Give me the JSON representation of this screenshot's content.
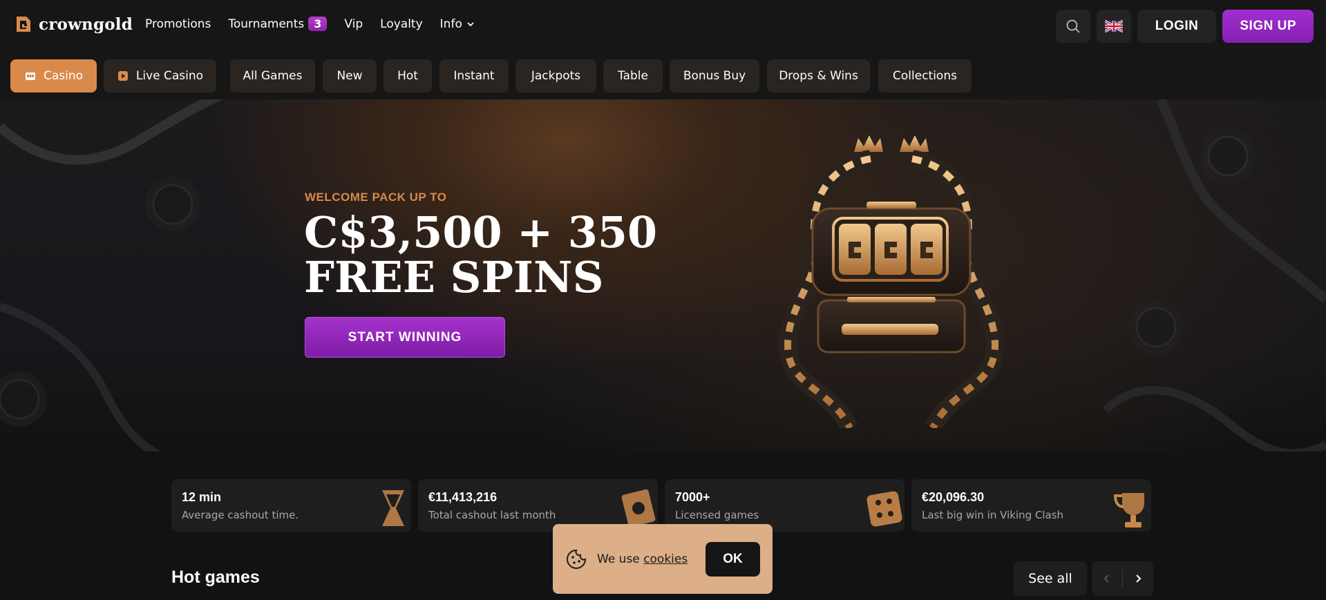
{
  "header": {
    "logo_text": "crowngold",
    "nav": [
      {
        "label": "Promotions"
      },
      {
        "label": "Tournaments",
        "badge": "3"
      },
      {
        "label": "Vip"
      },
      {
        "label": "Loyalty"
      },
      {
        "label": "Info"
      }
    ],
    "login_label": "LOGIN",
    "signup_label": "SIGN UP"
  },
  "categories": [
    {
      "label": "Casino",
      "icon": "casino-icon",
      "active": true
    },
    {
      "label": "Live Casino",
      "icon": "play-icon"
    },
    {
      "label": "All Games"
    },
    {
      "label": "New"
    },
    {
      "label": "Hot"
    },
    {
      "label": "Instant"
    },
    {
      "label": "Jackpots"
    },
    {
      "label": "Table"
    },
    {
      "label": "Bonus Buy"
    },
    {
      "label": "Drops & Wins"
    },
    {
      "label": "Collections"
    }
  ],
  "hero": {
    "subtitle": "WELCOME PACK UP TO",
    "title_line1": "C$3,500 + 350",
    "title_line2": "FREE SPINS",
    "cta": "START WINNING"
  },
  "stats": [
    {
      "value": "12 min",
      "label": "Average cashout time.",
      "icon": "hourglass-icon"
    },
    {
      "value": "€11,413,216",
      "label": "Total cashout last month",
      "icon": "cash-icon"
    },
    {
      "value": "7000+",
      "label": "Licensed games",
      "icon": "dice-icon"
    },
    {
      "value": "€20,096.30",
      "label": "Last big win in Viking Clash",
      "icon": "trophy-icon"
    }
  ],
  "hot_games": {
    "title": "Hot games",
    "see_all": "See all"
  },
  "cookie": {
    "text": "We use",
    "link": "cookies",
    "ok": "OK"
  },
  "colors": {
    "accent_orange": "#d98a4b",
    "accent_purple": "#9a2ac6",
    "cookie_bg": "#dcaf88"
  }
}
